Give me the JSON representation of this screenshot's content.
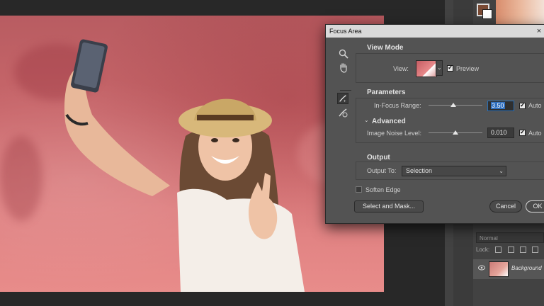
{
  "dialog": {
    "title": "Focus Area",
    "close_glyph": "×",
    "view_mode": {
      "heading": "View Mode",
      "view_label": "View:",
      "preview_label": "Preview",
      "preview_checked": true
    },
    "parameters": {
      "heading": "Parameters",
      "in_focus_label": "In-Focus Range:",
      "in_focus_value": "3.50",
      "in_focus_auto_label": "Auto",
      "in_focus_auto_checked": true,
      "advanced_heading": "Advanced",
      "noise_label": "Image Noise Level:",
      "noise_value": "0.010",
      "noise_auto_label": "Auto",
      "noise_auto_checked": true
    },
    "output": {
      "heading": "Output",
      "output_to_label": "Output To:",
      "output_to_value": "Selection"
    },
    "soften_edge_label": "Soften Edge",
    "soften_edge_checked": false,
    "select_and_mask_label": "Select and Mask...",
    "cancel_label": "Cancel",
    "ok_label": "OK"
  },
  "layers_panel": {
    "blend_mode": "Normal",
    "lock_label": "Lock:",
    "layer_name": "Background"
  },
  "colors": {
    "foreground": "#7a4a34",
    "background": "#ffffff",
    "overlay": "#d86a6e"
  }
}
